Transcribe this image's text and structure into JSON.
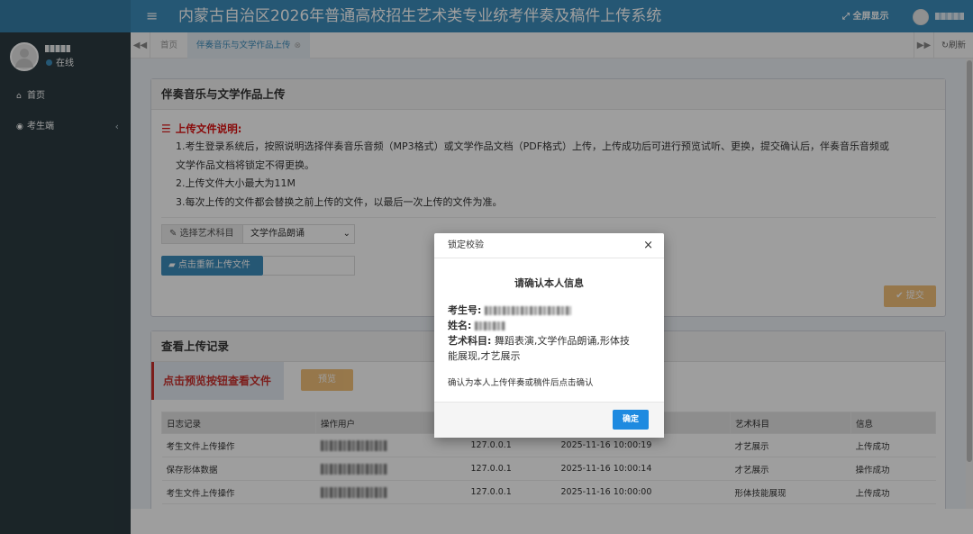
{
  "header": {
    "menu_toggle": "≡",
    "title": "内蒙古自治区2026年普通高校招生艺术类专业统考伴奏及稿件上传系统",
    "fullscreen_label": "全屏显示",
    "fullscreen_icon": "expand-icon"
  },
  "sidebar": {
    "status_label": "在线",
    "items": [
      {
        "label": "首页",
        "icon": "home-icon"
      },
      {
        "label": "考生端",
        "icon": "user-circle-icon"
      }
    ]
  },
  "tabbar": {
    "tabs": [
      {
        "label": "首页"
      },
      {
        "label": "伴奏音乐与文学作品上传",
        "active": true
      }
    ],
    "refresh_label": "刷新"
  },
  "upload_box": {
    "title": "伴奏音乐与文学作品上传",
    "instructions_title": "上传文件说明:",
    "instructions": [
      "1.考生登录系统后，按照说明选择伴奏音乐音频（MP3格式）或文学作品文档（PDF格式）上传，上传成功后可进行预览试听、更换，提交确认后，伴奏音乐音频或",
      "文学作品文档将锁定不得更换。",
      "2.上传文件大小最大为11M",
      "3.每次上传的文件都会替换之前上传的文件，以最后一次上传的文件为准。"
    ],
    "subject_label": "选择艺术科目",
    "subject_value": "文学作品朗诵",
    "reupload_label": "点击重新上传文件",
    "submit_label": "提交"
  },
  "records_box": {
    "title": "查看上传记录",
    "preview_hint": "点击预览按钮查看文件",
    "preview_label": "预览",
    "columns": [
      "日志记录",
      "操作用户",
      "",
      "",
      "艺术科目",
      "信息"
    ],
    "rows": [
      {
        "log": "考生文件上传操作",
        "ip": "127.0.0.1",
        "time": "2025-11-16 10:00:19",
        "subject": "才艺展示",
        "info": "上传成功"
      },
      {
        "log": "保存形体数据",
        "ip": "127.0.0.1",
        "time": "2025-11-16 10:00:14",
        "subject": "才艺展示",
        "info": "操作成功"
      },
      {
        "log": "考生文件上传操作",
        "ip": "127.0.0.1",
        "time": "2025-11-16 10:00:00",
        "subject": "形体技能展现",
        "info": "上传成功"
      }
    ]
  },
  "modal": {
    "header": "锁定校验",
    "close": "×",
    "title": "请确认本人信息",
    "exam_no_label": "考生号:",
    "name_label": "姓名:",
    "subjects_label": "艺术科目:",
    "subjects_line1": "舞蹈表演,文学作品朗诵,形体技",
    "subjects_line2": "能展现,才艺展示",
    "note": "确认为本人上传伴奏或稿件后点击确认",
    "confirm_label": "确定"
  },
  "colors": {
    "header_bg": "#3c8dbc",
    "sidebar_bg": "#2c3b41",
    "warning_red": "#dd1111",
    "warning_btn": "#f0ad4e",
    "confirm_btn": "#1e8ae0"
  }
}
